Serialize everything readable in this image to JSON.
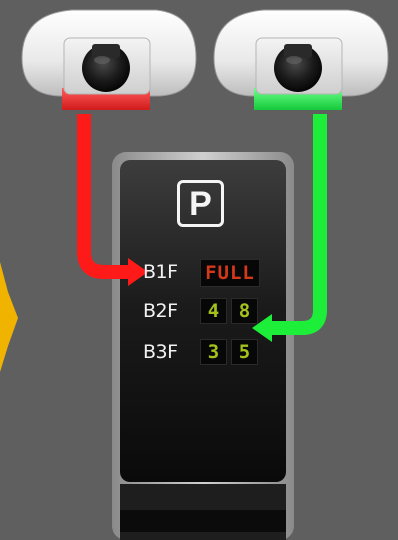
{
  "sign": {
    "symbol": "P",
    "levels": [
      {
        "label": "B1F",
        "status": "FULL"
      },
      {
        "label": "B2F",
        "digits": [
          "4",
          "8"
        ]
      },
      {
        "label": "B3F",
        "digits": [
          "3",
          "5"
        ]
      }
    ]
  },
  "sensors": [
    {
      "name": "left-sensor",
      "indicator_color": "#ff2222"
    },
    {
      "name": "right-sensor",
      "indicator_color": "#22ee44"
    }
  ],
  "colors": {
    "background": "#5f5f5f",
    "red_arrow": "#ff1a1a",
    "green_arrow": "#1cee3a",
    "full_text": "#d2381a",
    "digit_text": "#a4c21b",
    "side_marker": "#f0b400"
  }
}
